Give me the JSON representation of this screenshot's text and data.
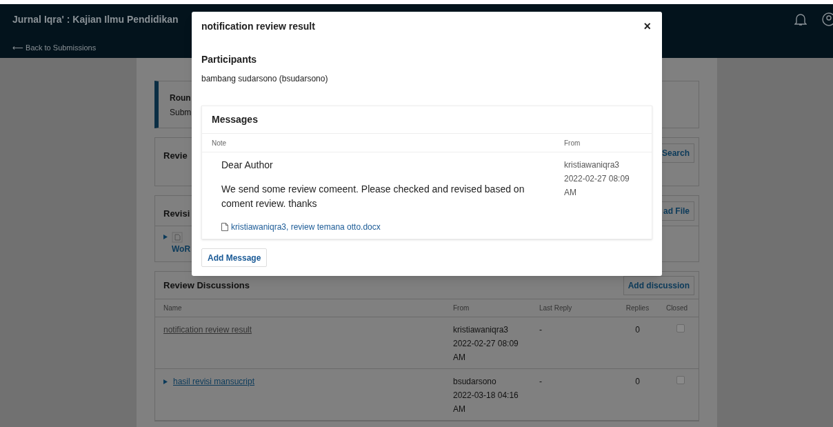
{
  "header": {
    "journal_title": "Jurnal Iqra' : Kajian Ilmu Pendidikan",
    "back_link": "⟵ Back to Submissions"
  },
  "round_card": {
    "title": "Roun",
    "subtitle": "Subm"
  },
  "reviewers_card": {
    "title": "Revie",
    "button": "Search"
  },
  "revisions_card": {
    "title": "Revisi",
    "button": "ad File",
    "file": {
      "label": "WoR",
      "expanded": false
    }
  },
  "discussions": {
    "title": "Review Discussions",
    "button": "Add discussion",
    "columns": [
      "Name",
      "From",
      "Last Reply",
      "Replies",
      "Closed"
    ],
    "rows": [
      {
        "kind": "plain",
        "name": "notification review result",
        "from_user": "kristiawaniqra3",
        "from_time": "2022-02-27 08:09 AM",
        "last_reply": "-",
        "replies": "0",
        "closed": false
      },
      {
        "kind": "expandable",
        "name": "hasil revisi mansucript",
        "from_user": "bsudarsono",
        "from_time": "2022-03-18 04:16 AM",
        "last_reply": "-",
        "replies": "0",
        "closed": false
      }
    ]
  },
  "modal": {
    "title": "notification review result",
    "close": "×",
    "participants_heading": "Participants",
    "participants": "bambang sudarsono (bsudarsono)",
    "messages": {
      "heading": "Messages",
      "columns": [
        "Note",
        "From"
      ],
      "items": [
        {
          "greeting": "Dear Author",
          "body": "We send some review comeent. Please checked and revised based on coment review. thanks",
          "attachment": "kristiawaniqra3, review temana otto.docx",
          "from_user": "kristiawaniqra3",
          "from_time": "2022-02-27 08:09 AM"
        }
      ]
    },
    "add_button": "Add Message"
  }
}
